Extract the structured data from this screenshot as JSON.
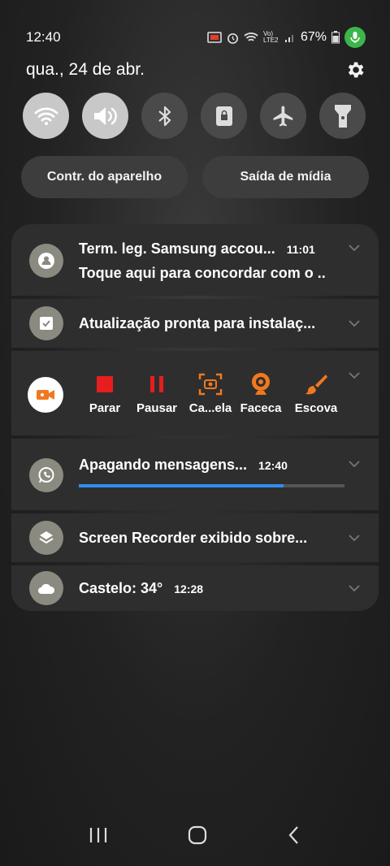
{
  "status": {
    "time": "12:40",
    "battery": "67%",
    "signal_text": "Vo) LTE2"
  },
  "date": "qua., 24 de abr.",
  "quick_settings": [
    {
      "name": "wifi",
      "state": "on"
    },
    {
      "name": "sound",
      "state": "on"
    },
    {
      "name": "bluetooth",
      "state": "off"
    },
    {
      "name": "rotation-lock",
      "state": "off"
    },
    {
      "name": "airplane",
      "state": "off"
    },
    {
      "name": "flashlight",
      "state": "off"
    }
  ],
  "buttons": {
    "device_control": "Contr. do aparelho",
    "media_output": "Saída de mídia"
  },
  "notifications": {
    "samsung": {
      "title": "Term. leg. Samsung accou...",
      "time": "11:01",
      "text": "Toque aqui para concordar com o .."
    },
    "update": {
      "title": "Atualização pronta para instalaç..."
    },
    "recorder": {
      "actions": [
        "Parar",
        "Pausar",
        "Ca...ela",
        "Faceca",
        "Escova"
      ]
    },
    "whatsapp": {
      "title": "Apagando mensagens...",
      "time": "12:40",
      "progress": 0.77
    },
    "screen_recorder": {
      "title": "Screen Recorder exibido sobre..."
    },
    "weather": {
      "title": "Castelo: 34°",
      "time": "12:28"
    }
  },
  "colors": {
    "accent_green": "#3cb54a",
    "recorder_red": "#e61e1e",
    "recorder_orange": "#f07820",
    "progress_blue": "#2f8ef0"
  }
}
